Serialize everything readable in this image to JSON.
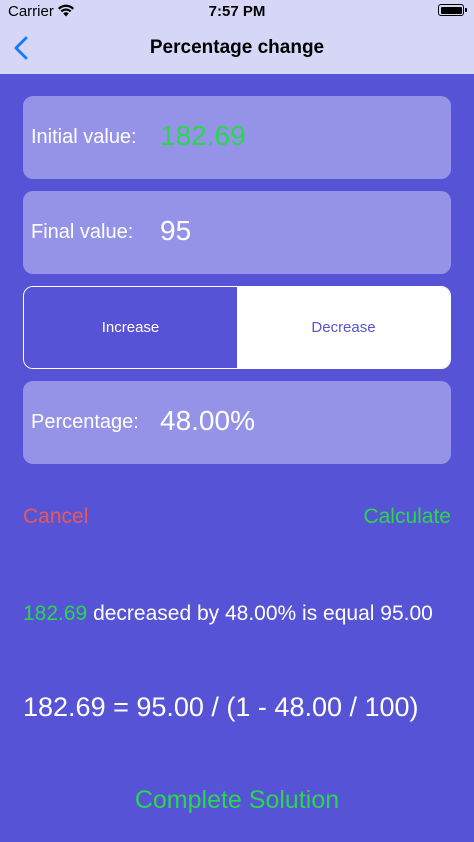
{
  "status_bar": {
    "carrier": "Carrier",
    "time": "7:57 PM"
  },
  "nav": {
    "title": "Percentage change"
  },
  "fields": {
    "initial": {
      "label": "Initial value:",
      "value": "182.69"
    },
    "final": {
      "label": "Final value:",
      "value": "95"
    },
    "percentage": {
      "label": "Percentage:",
      "value": "48.00%"
    }
  },
  "segment": {
    "increase": "Increase",
    "decrease": "Decrease",
    "selected": "Increase"
  },
  "actions": {
    "cancel": "Cancel",
    "calculate": "Calculate",
    "complete_solution": "Complete Solution"
  },
  "result": {
    "initial": "182.69",
    "text": " decreased by 48.00% is equal 95.00"
  },
  "formula": "182.69 = 95.00 / (1 - 48.00 / 100)",
  "colors": {
    "background": "#5753d6",
    "header": "#d6d6f7",
    "field": "#9593e8",
    "accent_green": "#27d94a",
    "cancel_red": "#e95858",
    "back_blue": "#1a7cf5"
  }
}
